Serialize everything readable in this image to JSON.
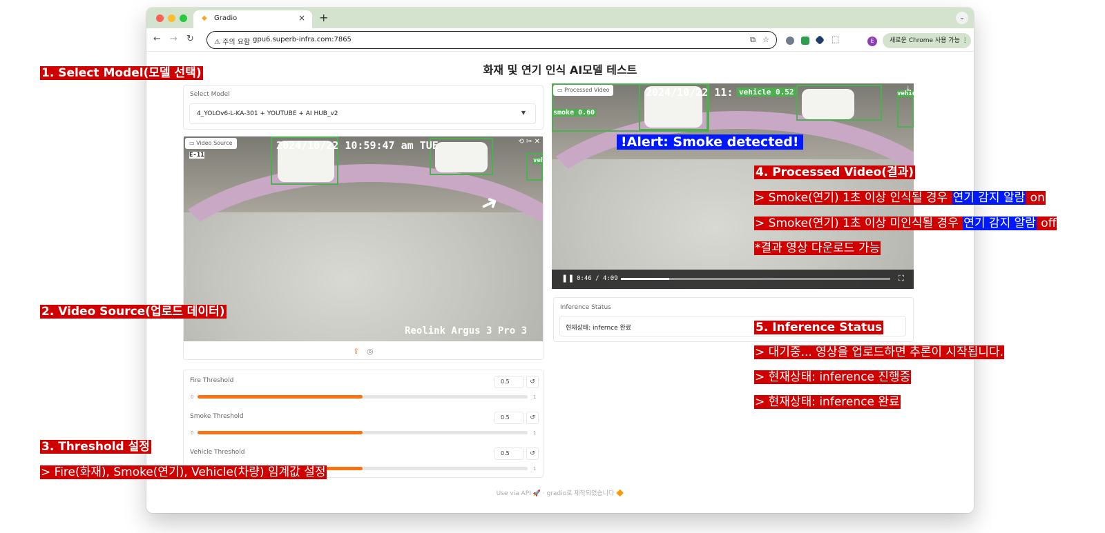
{
  "browser": {
    "tab_title": "Gradio",
    "new_tab": "+",
    "security_warning": "⚠ 주의 요함",
    "url": "gpu6.superb-infra.com:7865",
    "profile_initial": "E",
    "chrome_update": "새로운 Chrome 사용 가능"
  },
  "page": {
    "title": "화재 및 연기 인식 AI모델 테스트",
    "select_model": {
      "label": "Select Model",
      "value": "4_YOLOv6-L-KA-301 + YOUTUBE + AI HUB_v2"
    },
    "video_source": {
      "label": "Video Source",
      "timestamp": "2024/10/22 10:59:47 am TUE",
      "camera": "Reolink Argus 3 Pro 3",
      "cam_tag": "E-11",
      "edge_label": "veh"
    },
    "processed_video": {
      "label": "Processed Video",
      "timestamp": "2024/10/22 11:",
      "smoke_label": "smoke 0.60",
      "vehicle_label": "vehicle 0.52",
      "vehicle_edge": "vehicle",
      "alert": "!Alert: Smoke detected!",
      "time_current": "0:46",
      "time_total": "4:09",
      "progress": 0.18
    },
    "inference_status": {
      "label": "Inference Status",
      "value": "현재상태: infernce 완료"
    },
    "thresholds": [
      {
        "label": "Fire Threshold",
        "value": "0.5",
        "min": "0",
        "max": "1",
        "fraction": 0.5
      },
      {
        "label": "Smoke Threshold",
        "value": "0.5",
        "min": "0",
        "max": "1",
        "fraction": 0.5
      },
      {
        "label": "Vehicle Threshold",
        "value": "0.5",
        "min": "0",
        "max": "1",
        "fraction": 0.5
      }
    ],
    "footer": {
      "api": "Use via API 🚀",
      "sep": "·",
      "built": "gradio로 제작되었습니다 🔶"
    }
  },
  "annotations": {
    "a1": "1. Select Model(모델 선택)",
    "a2": "2. Video Source(업로드 데이터)",
    "a3_title": "3. Threshold 설정",
    "a3_text": "> Fire(화재), Smoke(연기), Vehicle(차량) 임계값 설정",
    "a4_title": "4. Processed Video(결과)",
    "a4_l1a": "> Smoke(연기) 1초 이상 인식될 경우 ",
    "a4_l1b": "연기 감지 알람",
    "a4_l1c": " on",
    "a4_l2a": "> Smoke(연기) 1초 이상 미인식될 경우 ",
    "a4_l2b": "연기 감지 알람",
    "a4_l2c": " off",
    "a4_l3": "*결과 영상 다운로드 가능",
    "a5_title": "5. Inference Status",
    "a5_l1": "> 대기중... 영상을 업로드하면 추론이 시작됩니다.",
    "a5_l2": "> 현재상태: inference 진행중",
    "a5_l3": "> 현재상태: inference 완료"
  },
  "colors": {
    "accent_orange": "#f97316",
    "annotation_red": "#d00000",
    "annotation_blue": "#0019ff",
    "bbox_green": "#4caf50",
    "tabstrip_green": "#d3e3cd"
  }
}
